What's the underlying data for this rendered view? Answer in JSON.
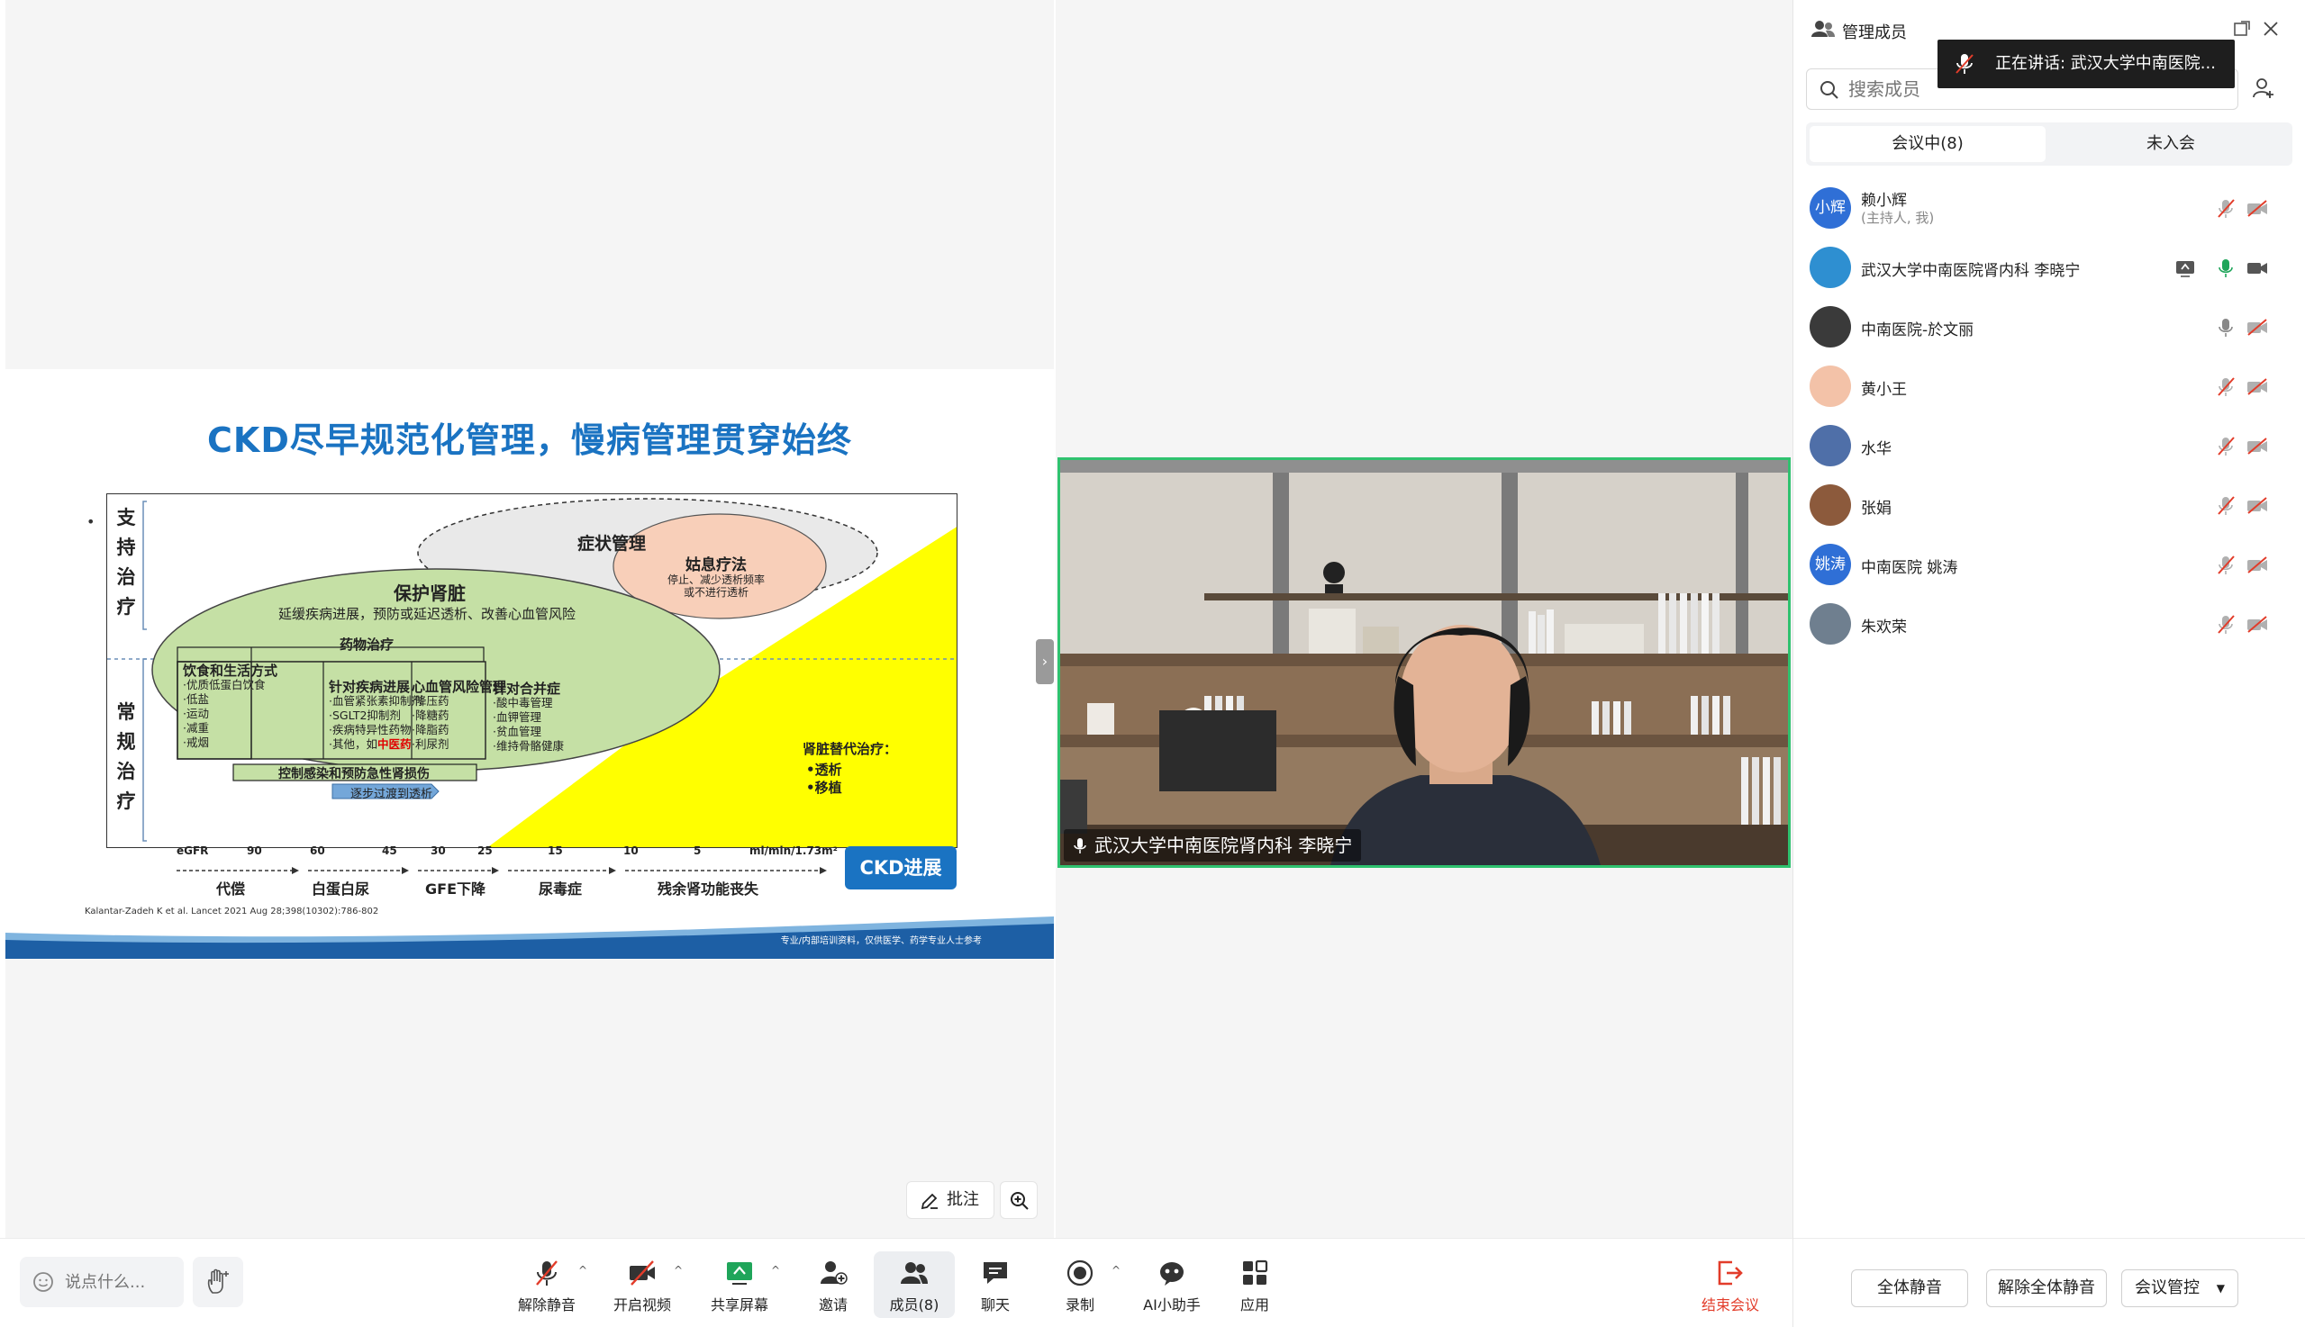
{
  "slide": {
    "title": "CKD尽早规范化管理，慢病管理贯穿始终",
    "bullet": "•",
    "support_label": [
      "支",
      "持",
      "治",
      "疗"
    ],
    "routine_label": [
      "常",
      "规",
      "治",
      "疗"
    ],
    "symptom_mgmt": "症状管理",
    "palliative_title": "姑息疗法",
    "palliative_desc1": "停止、减少透析频率",
    "palliative_desc2": "或不进行透析",
    "protect_kidney": "保护肾脏",
    "protect_desc": "延缓疾病进展，预防或延迟透析、改善心血管风险",
    "drug_therapy": "药物治疗",
    "diet": {
      "title": "饮食和生活方式",
      "items": [
        "·优质低蛋白饮食",
        "·低盐",
        "·运动",
        "·减重",
        "·戒烟"
      ]
    },
    "disease": {
      "title": "针对疾病进展",
      "items": [
        "·血管紧张素抑制剂",
        "·SGLT2抑制剂",
        "·疾病特异性药物",
        "·其他，如"
      ],
      "highlight": "中医药"
    },
    "cardio": {
      "title": "心血管风险管理",
      "items": [
        "·降压药",
        "·降糖药",
        "·降脂药",
        "·利尿剂"
      ]
    },
    "complication": {
      "title": "针对合并症",
      "items": [
        "·酸中毒管理",
        "·血钾管理",
        "·贫血管理",
        "·维持骨骼健康"
      ]
    },
    "infection": "控制感染和预防急性肾损伤",
    "transition": "逐步过渡到透析",
    "renal_title": "肾脏替代治疗：",
    "renal_items": [
      "•透析",
      "•移植"
    ],
    "egfr_label": "eGFR",
    "egfr_ticks": [
      "90",
      "60",
      "45",
      "30",
      "25",
      "15",
      "10",
      "5"
    ],
    "egfr_unit": "ml/min/1.73m²",
    "stages": [
      "代偿",
      "白蛋白尿",
      "GFE下降",
      "尿毒症",
      "残余肾功能丧失"
    ],
    "ckd_badge": "CKD进展",
    "citation": "Kalantar-Zadeh K et al. Lancet 2021 Aug 28;398(10302):786-802",
    "footer": "专业/内部培训资料，仅供医学、药学专业人士参考"
  },
  "share": {
    "collapse_glyph": "›",
    "annotate_label": "批注"
  },
  "video": {
    "name": "武汉大学中南医院肾内科 李晓宁"
  },
  "panel": {
    "title": "管理成员",
    "speaking_tip": "正在讲话:  武汉大学中南医院...",
    "search_placeholder": "搜索成员",
    "tabs": [
      "会议中(8)",
      "未入会"
    ],
    "members": [
      {
        "name": "赖小辉",
        "sub": "(主持人, 我)",
        "avatar_text": "小辉",
        "avatar_color": "#2f6fd6",
        "mic": "muted",
        "cam": "off"
      },
      {
        "name": "武汉大学中南医院肾内科 李晓宁",
        "avatar_text": "",
        "avatar_color": "#2e8fd1",
        "mic": "on",
        "cam": "on",
        "sharing": true
      },
      {
        "name": "中南医院-於文丽",
        "avatar_text": "",
        "avatar_color": "#3a3a3a",
        "mic": "on-gray",
        "cam": "off"
      },
      {
        "name": "黄小王",
        "avatar_text": "",
        "avatar_color": "#f3c2a8",
        "mic": "muted",
        "cam": "off"
      },
      {
        "name": "水华",
        "avatar_text": "",
        "avatar_color": "#4f6fa8",
        "mic": "muted",
        "cam": "off"
      },
      {
        "name": "张娟",
        "avatar_text": "",
        "avatar_color": "#8c5a3c",
        "mic": "muted",
        "cam": "off"
      },
      {
        "name": "中南医院 姚涛",
        "avatar_text": "姚涛",
        "avatar_color": "#2f6fd6",
        "mic": "muted",
        "cam": "off"
      },
      {
        "name": "朱欢荣",
        "avatar_text": "",
        "avatar_color": "#6f7f8f",
        "mic": "muted",
        "cam": "off"
      }
    ],
    "buttons": [
      "全体静音",
      "解除全体静音",
      "会议管控"
    ]
  },
  "toolbar": {
    "chat_placeholder": "说点什么...",
    "items": [
      {
        "label": "解除静音",
        "icon": "mic-muted-icon"
      },
      {
        "label": "开启视频",
        "icon": "camera-off-icon"
      },
      {
        "label": "共享屏幕",
        "icon": "share-screen-icon"
      },
      {
        "label": "邀请",
        "icon": "invite-icon"
      },
      {
        "label": "成员(8)",
        "icon": "members-icon"
      },
      {
        "label": "聊天",
        "icon": "chat-icon"
      },
      {
        "label": "录制",
        "icon": "record-icon"
      },
      {
        "label": "AI小助手",
        "icon": "ai-assistant-icon"
      },
      {
        "label": "应用",
        "icon": "apps-icon"
      },
      {
        "label": "结束会议",
        "icon": "end-meeting-icon"
      }
    ]
  },
  "colors": {
    "accent": "#1a73c2",
    "active_speaker": "#2fc26f",
    "danger": "#e23c2a",
    "avatar_blue": "#2f6fd6"
  }
}
